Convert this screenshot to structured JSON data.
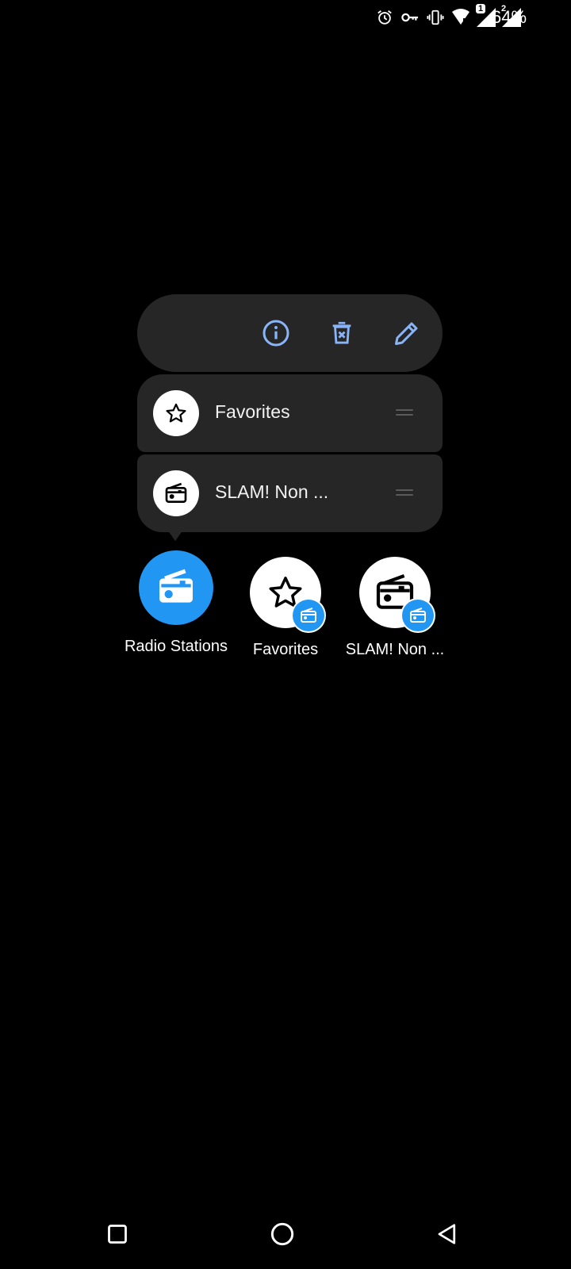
{
  "status_bar": {
    "battery": "64%",
    "sim1": "1",
    "sim2": "2",
    "icons": [
      "alarm-icon",
      "vpn-key-icon",
      "vibrate-icon",
      "wifi-icon",
      "signal-sim1-icon",
      "signal-sim2-icon"
    ]
  },
  "popup": {
    "actions": [
      "info-icon",
      "delete-icon",
      "edit-icon"
    ],
    "accent": "#8ab4f8",
    "shortcuts": [
      {
        "label": "Favorites",
        "icon": "star-icon"
      },
      {
        "label": "SLAM! Non ...",
        "icon": "radio-icon"
      }
    ]
  },
  "apps": [
    {
      "label": "Radio Stations",
      "icon": "radio-icon",
      "color": "#2196f3"
    },
    {
      "label": "Favorites",
      "icon": "star-icon"
    },
    {
      "label": "SLAM! Non ...",
      "icon": "radio-icon"
    }
  ],
  "nav": [
    "recents-button",
    "home-button",
    "back-button"
  ]
}
